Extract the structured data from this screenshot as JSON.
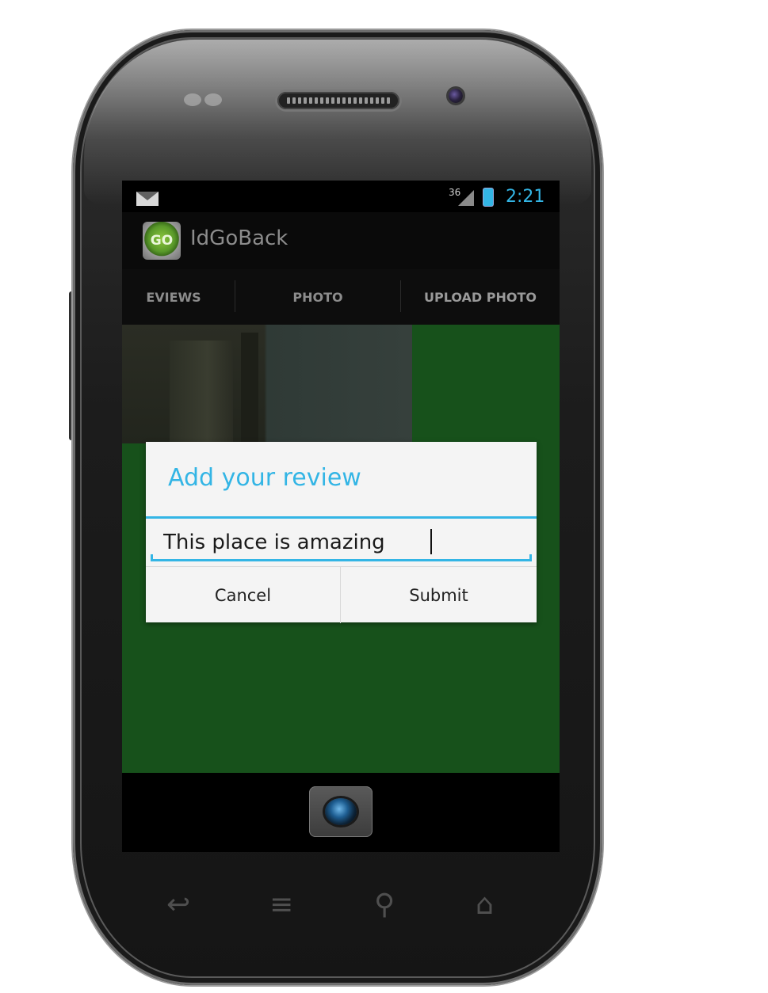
{
  "status_bar": {
    "signal_label": "36",
    "time": "2:21"
  },
  "action_bar": {
    "app_icon_text": "GO",
    "title": "IdGoBack"
  },
  "tabs": [
    {
      "label": "EVIEWS"
    },
    {
      "label": "PHOTO"
    },
    {
      "label": "UPLOAD PHOTO",
      "selected": true
    }
  ],
  "dialog": {
    "title": "Add your review",
    "input_value": "This place is amazing",
    "cancel_label": "Cancel",
    "submit_label": "Submit"
  },
  "hardware_keys": {
    "back_glyph": "↩",
    "menu_glyph": "≡",
    "search_glyph": "⚲",
    "home_glyph": "⌂"
  },
  "colors": {
    "accent": "#33b5e5",
    "content_bg": "#17511b",
    "dialog_bg": "#f4f4f4"
  },
  "icons": [
    "mail-icon",
    "signal-icon",
    "battery-icon",
    "app-icon",
    "camera-icon",
    "back-icon",
    "menu-icon",
    "search-icon",
    "home-icon"
  ]
}
